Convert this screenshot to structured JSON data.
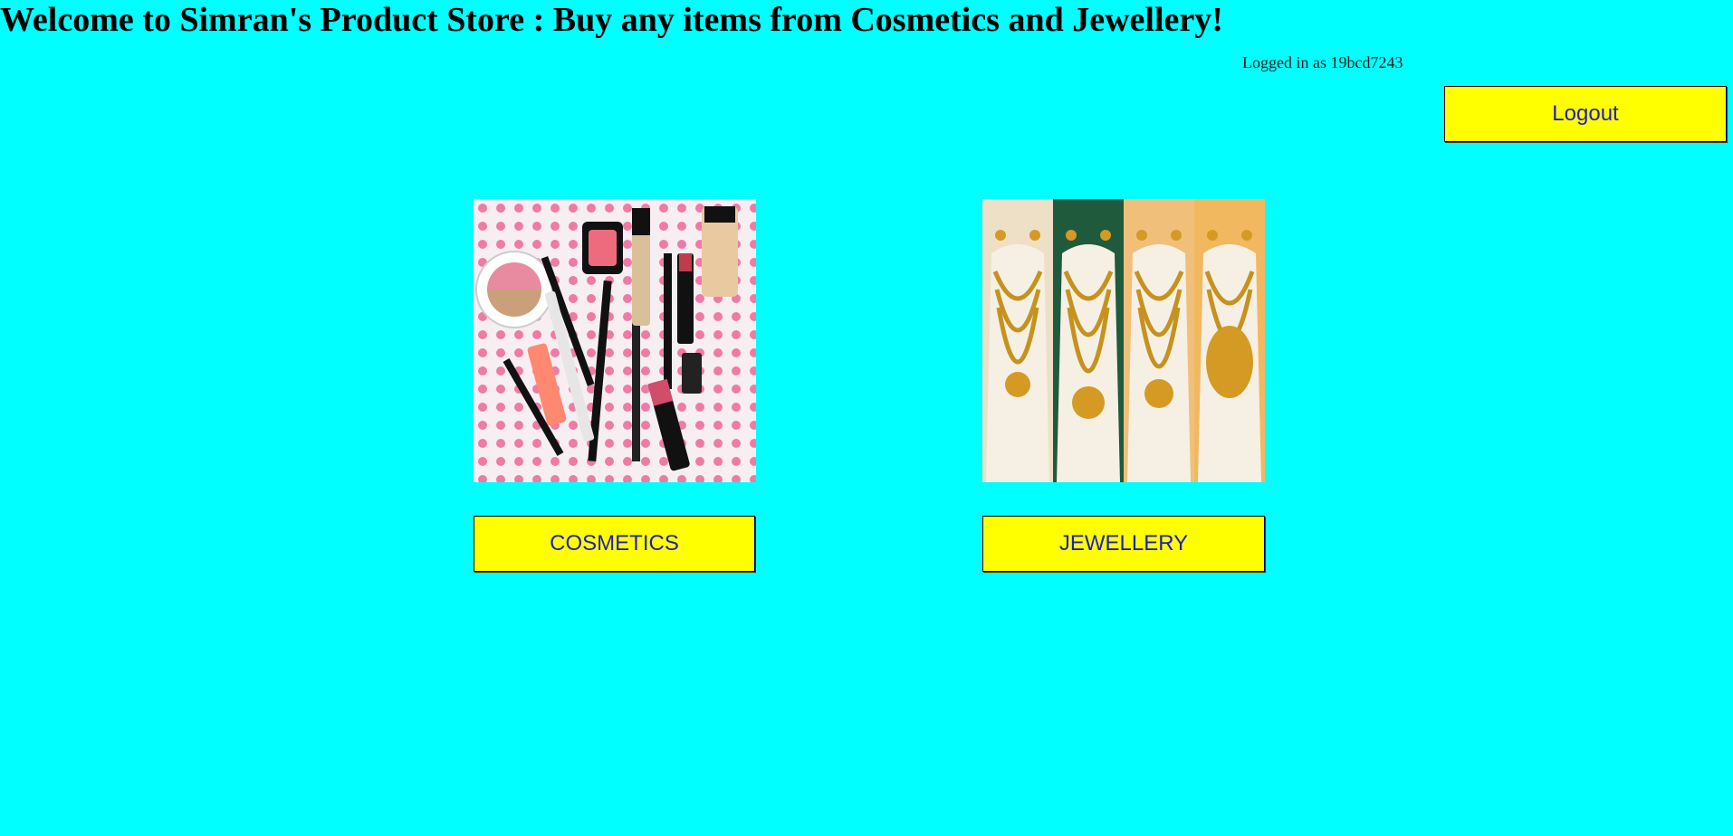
{
  "header": {
    "title": "Welcome to Simran's Product Store : Buy any items from Cosmetics and Jewellery!",
    "login_status": "Logged in as 19bcd7243",
    "logout_label": "Logout"
  },
  "categories": [
    {
      "label": "COSMETICS",
      "image_alt": "cosmetics-photo"
    },
    {
      "label": "JEWELLERY",
      "image_alt": "jewellery-photo"
    }
  ],
  "colors": {
    "background": "#00ffff",
    "button": "#ffff00",
    "button_text": "#1f1fbf"
  }
}
